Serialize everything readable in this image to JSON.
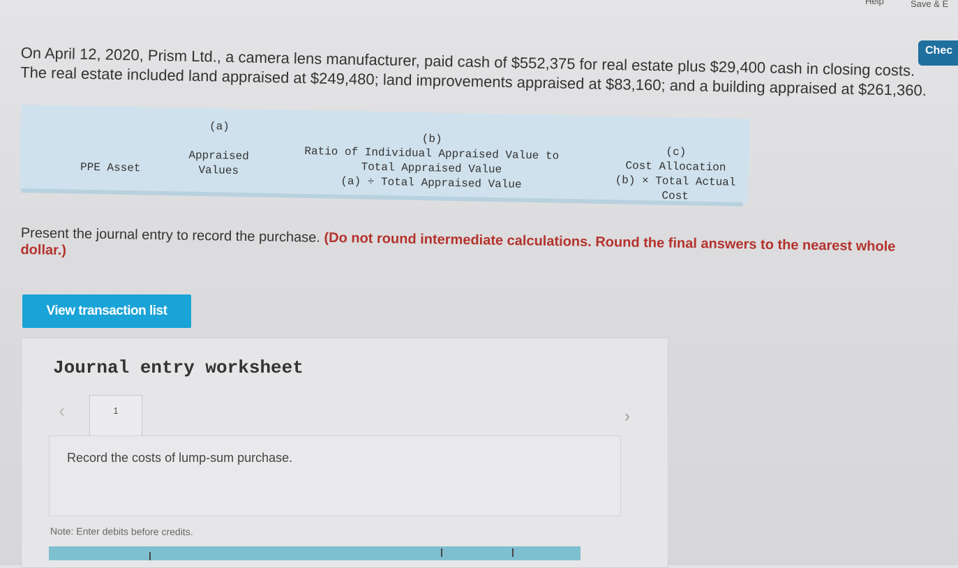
{
  "topbar": {
    "help_label": "Help",
    "save_label": "Save & E",
    "check_label": "Chec"
  },
  "problem": {
    "line1": "On April 12, 2020, Prism Ltd., a camera lens manufacturer, paid cash of $552,375 for real estate plus $29,400 cash in closing costs.",
    "line2": "The real estate included land appraised at $249,480; land improvements appraised at $83,160; and a building appraised at $261,360."
  },
  "table": {
    "col1": "PPE Asset",
    "col2_letter": "(a)",
    "col2_line1": "Appraised",
    "col2_line2": "Values",
    "col3_letter": "(b)",
    "col3_line1": "Ratio of Individual Appraised Value to",
    "col3_line2": "Total Appraised Value",
    "col3_line3": "(a) ÷ Total Appraised Value",
    "col4_letter": "(c)",
    "col4_line1": "Cost Allocation",
    "col4_line2": "(b) × Total Actual",
    "col4_line3": "Cost"
  },
  "instructions": {
    "text": "Present the journal entry to record the purchase.",
    "emphasis": "(Do not round intermediate calculations. Round the final answers to the nearest whole dollar.)"
  },
  "view_button": "View transaction list",
  "worksheet": {
    "title": "Journal entry worksheet",
    "page_number": "1",
    "record_text": "Record the costs of lump-sum purchase.",
    "note": "Note: Enter debits before credits."
  }
}
